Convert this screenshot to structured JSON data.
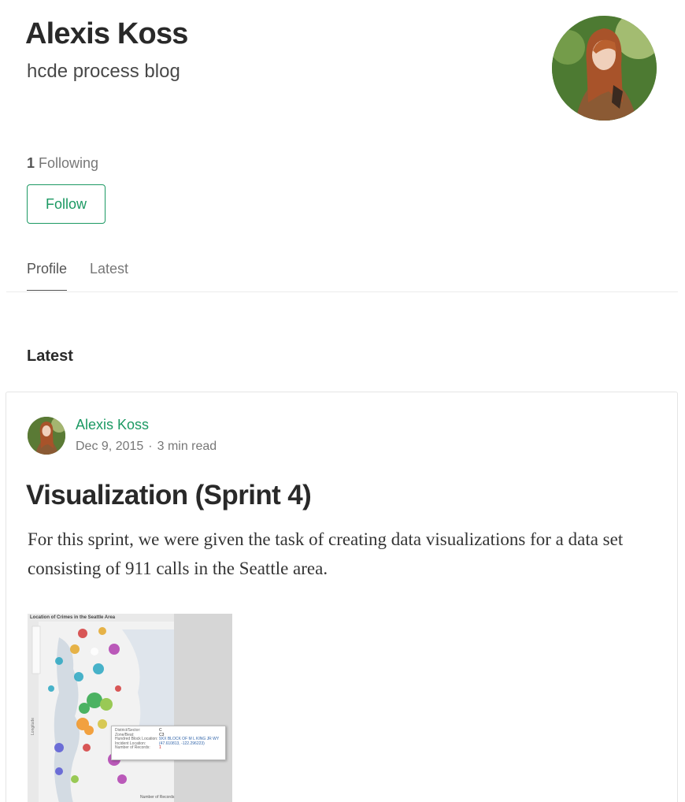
{
  "profile": {
    "name": "Alexis Koss",
    "bio": "hcde process blog",
    "following_count": "1",
    "following_label": "Following",
    "follow_button": "Follow"
  },
  "tabs": [
    {
      "label": "Profile",
      "active": true
    },
    {
      "label": "Latest",
      "active": false
    }
  ],
  "section": {
    "title": "Latest"
  },
  "post": {
    "author": "Alexis Koss",
    "date": "Dec 9, 2015",
    "separator": "·",
    "read_time": "3 min read",
    "title": "Visualization (Sprint 4)",
    "excerpt": "For this sprint, we were given the task of creating data visualizations for a data set consisting of 911 calls in the Seattle area.",
    "image": {
      "title": "Location of Crimes in the Seattle Area",
      "tooltip": [
        {
          "key": "District/Sector:",
          "value": "C"
        },
        {
          "key": "Zone/Beat:",
          "value": "C3"
        },
        {
          "key": "Hundred Block Location:",
          "value": "9XX BLOCK OF M L KING JR WY"
        },
        {
          "key": "Incident Location:",
          "value": "(47.610813, -122.296223)"
        },
        {
          "key": "Number of Records:",
          "value": "1"
        }
      ],
      "axis_label": "Longitude",
      "footer": "Number of Records"
    }
  },
  "colors": {
    "accent": "#1c9963",
    "text_primary": "rgba(0,0,0,0.84)",
    "text_secondary": "rgba(0,0,0,0.54)"
  }
}
